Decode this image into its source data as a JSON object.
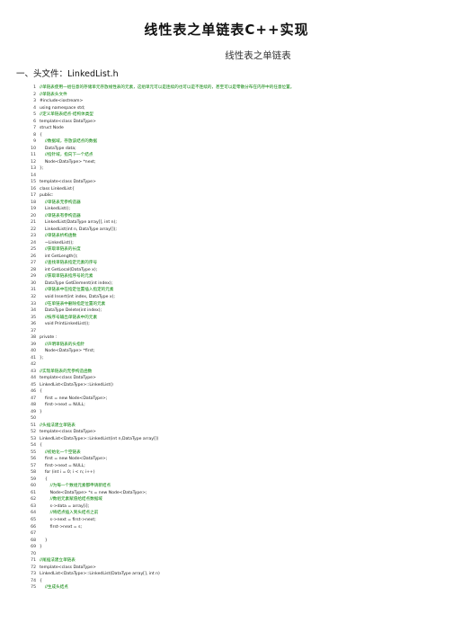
{
  "title": "线性表之单链表C++实现",
  "subtitle": "线性表之单链表",
  "section": "一、头文件：LinkedList.h",
  "code_lines": [
    {
      "n": "1",
      "text": "//单链表使用一组任意的存储单元存放线性表的元素，这组单元可以是连续的也可以是不连续的，甚至可以是零散分布在内存中的任意位置。",
      "kind": "comment"
    },
    {
      "n": "2",
      "text": "//单链表头文件",
      "kind": "comment"
    },
    {
      "n": "3",
      "text": "#include<iostream>",
      "kind": "plain"
    },
    {
      "n": "4",
      "text": "using namespace std;",
      "kind": "plain"
    },
    {
      "n": "5",
      "text": "//定义单链表结点-结构体类型",
      "kind": "comment"
    },
    {
      "n": "6",
      "text": "template<class DataType>",
      "kind": "plain"
    },
    {
      "n": "7",
      "text": "struct Node",
      "kind": "plain"
    },
    {
      "n": "8",
      "text": "{",
      "kind": "plain"
    },
    {
      "n": "9",
      "text": "    //数据域，存放该结点的数据",
      "kind": "comment"
    },
    {
      "n": "10",
      "text": "    DataType data;",
      "kind": "plain"
    },
    {
      "n": "11",
      "text": "    //指针域，指向下一个结点",
      "kind": "comment"
    },
    {
      "n": "12",
      "text": "    Node<DataType> *next;",
      "kind": "plain"
    },
    {
      "n": "13",
      "text": "};",
      "kind": "plain"
    },
    {
      "n": "14",
      "text": "",
      "kind": "plain"
    },
    {
      "n": "15",
      "text": "template<class DataType>",
      "kind": "plain"
    },
    {
      "n": "16",
      "text": "class LinkedList{",
      "kind": "plain"
    },
    {
      "n": "17",
      "text": "public:",
      "kind": "plain"
    },
    {
      "n": "18",
      "text": "    //单链表无参构造器",
      "kind": "comment"
    },
    {
      "n": "19",
      "text": "    LinkedList();",
      "kind": "plain"
    },
    {
      "n": "20",
      "text": "    //单链表有参构造器",
      "kind": "comment"
    },
    {
      "n": "21",
      "text": "    LinkedList(DataType array[], int n);",
      "kind": "plain"
    },
    {
      "n": "22",
      "text": "    LinkedList(int n, DataType array[]);",
      "kind": "plain"
    },
    {
      "n": "23",
      "text": "    //单链表析构函数",
      "kind": "comment"
    },
    {
      "n": "24",
      "text": "    ~LinkedList();",
      "kind": "plain"
    },
    {
      "n": "25",
      "text": "    //获取单链表的长度",
      "kind": "comment"
    },
    {
      "n": "26",
      "text": "    int GetLength();",
      "kind": "plain"
    },
    {
      "n": "27",
      "text": "    //查找单链表指定元素的序号",
      "kind": "comment"
    },
    {
      "n": "28",
      "text": "    int GetLocal(DataType x);",
      "kind": "plain"
    },
    {
      "n": "29",
      "text": "    //获取单链表指序号的元素",
      "kind": "comment"
    },
    {
      "n": "30",
      "text": "    DataType GetElement(int index);",
      "kind": "plain"
    },
    {
      "n": "31",
      "text": "    //单链表中在指定位置插入指定的元素",
      "kind": "comment"
    },
    {
      "n": "32",
      "text": "    void Insert(int index, DataType x);",
      "kind": "plain"
    },
    {
      "n": "33",
      "text": "    //在单链表中删除指定位置的元素",
      "kind": "comment"
    },
    {
      "n": "34",
      "text": "    DataType Delete(int index);",
      "kind": "plain"
    },
    {
      "n": "35",
      "text": "    //按序号输出单链表中的元素",
      "kind": "comment"
    },
    {
      "n": "36",
      "text": "    void PrintLinkedList();",
      "kind": "plain"
    },
    {
      "n": "37",
      "text": "",
      "kind": "plain"
    },
    {
      "n": "38",
      "text": "private :",
      "kind": "plain"
    },
    {
      "n": "39",
      "text": "    //声明单链表的头指针",
      "kind": "comment"
    },
    {
      "n": "40",
      "text": "    Node<DataType> *first;",
      "kind": "plain"
    },
    {
      "n": "41",
      "text": "};",
      "kind": "plain"
    },
    {
      "n": "42",
      "text": "",
      "kind": "plain"
    },
    {
      "n": "43",
      "text": "//实现单链表的无参构造函数",
      "kind": "comment"
    },
    {
      "n": "44",
      "text": "template<class DataType>",
      "kind": "plain"
    },
    {
      "n": "45",
      "text": "LinkedList<DataType>::LinkedList()",
      "kind": "plain"
    },
    {
      "n": "46",
      "text": "{",
      "kind": "plain"
    },
    {
      "n": "47",
      "text": "    first = new Node<DataType>;",
      "kind": "plain"
    },
    {
      "n": "48",
      "text": "    first->next = NULL;",
      "kind": "plain"
    },
    {
      "n": "49",
      "text": "}",
      "kind": "plain"
    },
    {
      "n": "50",
      "text": "",
      "kind": "plain"
    },
    {
      "n": "51",
      "text": "//头插法建立单链表",
      "kind": "comment"
    },
    {
      "n": "52",
      "text": "template<class DataType>",
      "kind": "plain"
    },
    {
      "n": "53",
      "text": "LinkedList<DataType>::LinkedList(int n,DataType array[])",
      "kind": "plain"
    },
    {
      "n": "54",
      "text": "{",
      "kind": "plain"
    },
    {
      "n": "55",
      "text": "    //初始化一个空链表",
      "kind": "comment"
    },
    {
      "n": "56",
      "text": "    first = new Node<DataType>;",
      "kind": "plain"
    },
    {
      "n": "57",
      "text": "    first->next = NULL;",
      "kind": "plain"
    },
    {
      "n": "58",
      "text": "    for (int i = 0; i < n; i++)",
      "kind": "plain"
    },
    {
      "n": "59",
      "text": "    {",
      "kind": "plain"
    },
    {
      "n": "60",
      "text": "        //为每一个数组元素都申请新结点",
      "kind": "comment"
    },
    {
      "n": "61",
      "text": "        Node<DataType> *s = new Node<DataType>;",
      "kind": "plain"
    },
    {
      "n": "62",
      "text": "        //数组元素赋值给结点数据域",
      "kind": "comment"
    },
    {
      "n": "63",
      "text": "        s->data = array[i];",
      "kind": "plain"
    },
    {
      "n": "64",
      "text": "        //将结点插入到头结点之前",
      "kind": "comment"
    },
    {
      "n": "65",
      "text": "        s->next = first->next;",
      "kind": "plain"
    },
    {
      "n": "66",
      "text": "        first->next = s;",
      "kind": "plain"
    },
    {
      "n": "67",
      "text": "",
      "kind": "plain"
    },
    {
      "n": "68",
      "text": "    }",
      "kind": "plain"
    },
    {
      "n": "69",
      "text": "}",
      "kind": "plain"
    },
    {
      "n": "70",
      "text": "",
      "kind": "plain"
    },
    {
      "n": "71",
      "text": "//尾插法建立单链表",
      "kind": "comment"
    },
    {
      "n": "72",
      "text": "template<class DataType>",
      "kind": "plain"
    },
    {
      "n": "73",
      "text": "LinkedList<DataType>::LinkedList(DataType array[], int n)",
      "kind": "plain"
    },
    {
      "n": "74",
      "text": "{",
      "kind": "plain"
    },
    {
      "n": "75",
      "text": "    //生成头结点",
      "kind": "comment"
    }
  ]
}
